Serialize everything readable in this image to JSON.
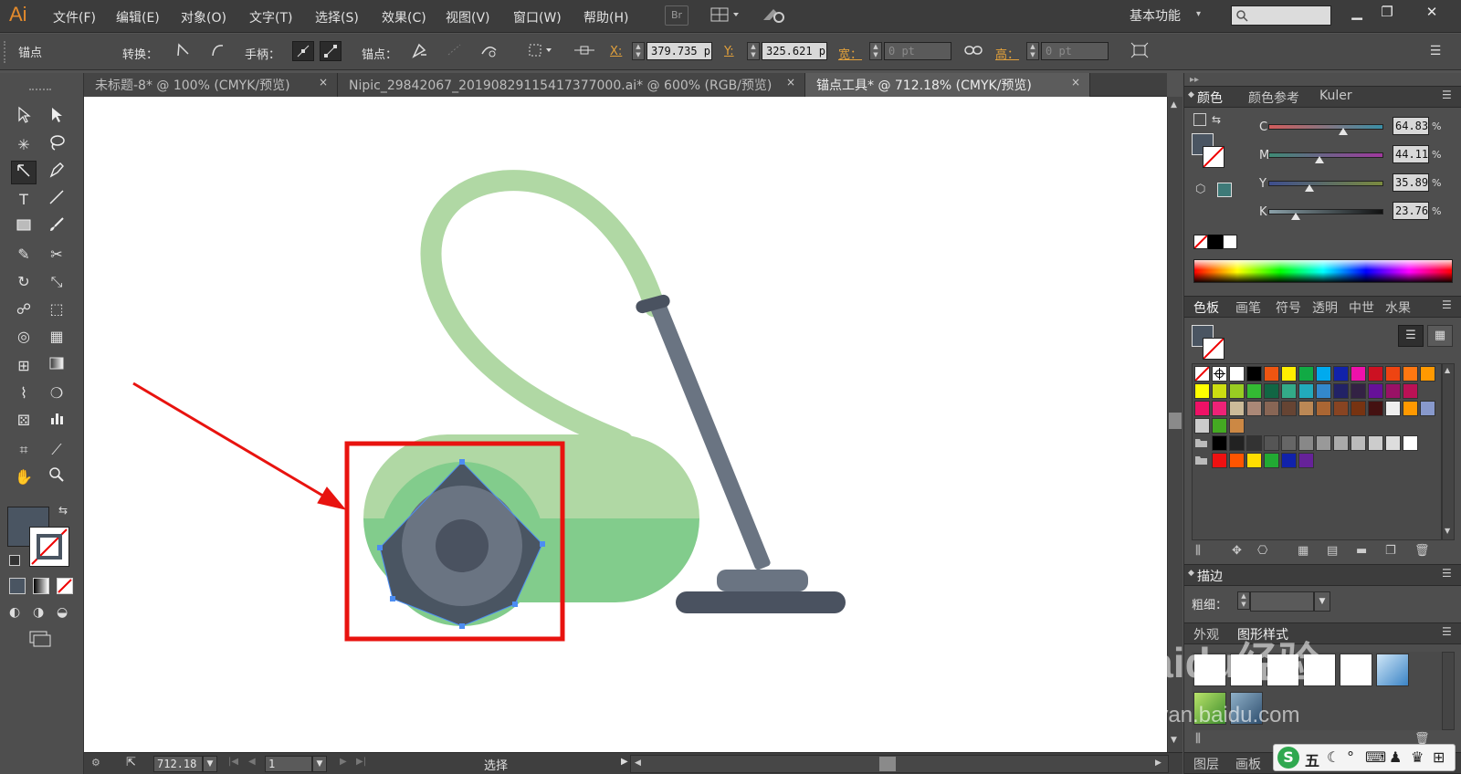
{
  "app": {
    "logo": "Ai"
  },
  "menu": [
    "文件(F)",
    "编辑(E)",
    "对象(O)",
    "文字(T)",
    "选择(S)",
    "效果(C)",
    "视图(V)",
    "窗口(W)",
    "帮助(H)"
  ],
  "menu_icons": {
    "bridge": "Br"
  },
  "workspace": "基本功能",
  "control_bar": {
    "tool_name": "锚点",
    "convert_label": "转换：",
    "handles_label": "手柄：",
    "anchors_label": "锚点：",
    "x_label": "X:",
    "x_value": "379.735 p",
    "y_label": "Y:",
    "y_value": "325.621 p",
    "w_label": "宽：",
    "w_value": "0 pt",
    "h_label": "高：",
    "h_value": "0 pt"
  },
  "tabs": [
    {
      "label": "未标题-8* @ 100% (CMYK/预览)",
      "active": false
    },
    {
      "label": "Nipic_29842067_20190829115417377000.ai* @ 600% (RGB/预览)",
      "active": false
    },
    {
      "label": "锚点工具* @ 712.18% (CMYK/预览)",
      "active": true
    }
  ],
  "tab_close": "×",
  "status": {
    "zoom": "712.18",
    "artboard": "1",
    "mode": "选择"
  },
  "color_panel": {
    "tabs": [
      "颜色",
      "颜色参考",
      "Kuler"
    ],
    "channels": [
      {
        "label": "C",
        "value": "64.83",
        "percent": 64.83
      },
      {
        "label": "M",
        "value": "44.11",
        "percent": 44.11
      },
      {
        "label": "Y",
        "value": "35.89",
        "percent": 35.89
      },
      {
        "label": "K",
        "value": "23.76",
        "percent": 23.76
      }
    ],
    "pct_sign": "%"
  },
  "swatch_panel": {
    "tabs": [
      "色板",
      "画笔",
      "符号",
      "透明",
      "中世",
      "水果"
    ]
  },
  "stroke_panel": {
    "title": "描边",
    "weight_label": "粗细："
  },
  "appearance_panel": {
    "tabs": [
      "外观",
      "图形样式"
    ]
  },
  "bottom_tabs": [
    "图层",
    "画板"
  ],
  "watermark": {
    "text": "Baidu经验",
    "url": "jingyan.baidu.com"
  },
  "ime": {
    "label": "五"
  },
  "colors": {
    "fill": "#4a5562",
    "body_light": "#b0d8a4",
    "body_dark": "#82cc8c",
    "steel": "#6a7482",
    "dark": "#4a5260",
    "highlight": "#e8130f"
  }
}
